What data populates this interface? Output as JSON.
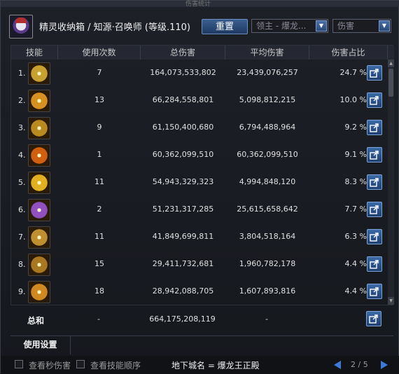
{
  "titlebar": "伤害统计",
  "header": {
    "character": "精灵收纳箱 / 知源·召唤师 (等级.110)",
    "reset_label": "重置",
    "boss_select": "领主 - 爆龙...",
    "type_select": "伤害"
  },
  "columns": [
    "技能",
    "使用次数",
    "总伤害",
    "平均伤害",
    "伤害占比"
  ],
  "rows": [
    {
      "idx": "1.",
      "icon": "skill-icon-1",
      "color": "#c8a030",
      "count": "7",
      "total": "164,073,533,802",
      "avg": "23,439,076,257",
      "pct": "24.7 %"
    },
    {
      "idx": "2.",
      "icon": "skill-icon-2",
      "color": "#d89020",
      "count": "13",
      "total": "66,284,558,801",
      "avg": "5,098,812,215",
      "pct": "10.0 %"
    },
    {
      "idx": "3.",
      "icon": "skill-icon-3",
      "color": "#b88a20",
      "count": "9",
      "total": "61,150,400,680",
      "avg": "6,794,488,964",
      "pct": "9.2 %"
    },
    {
      "idx": "4.",
      "icon": "skill-icon-4",
      "color": "#d06010",
      "count": "1",
      "total": "60,362,099,510",
      "avg": "60,362,099,510",
      "pct": "9.1 %"
    },
    {
      "idx": "5.",
      "icon": "skill-icon-5",
      "color": "#e0b020",
      "count": "11",
      "total": "54,943,329,323",
      "avg": "4,994,848,120",
      "pct": "8.3 %"
    },
    {
      "idx": "6.",
      "icon": "skill-icon-6",
      "color": "#9050c0",
      "count": "2",
      "total": "51,231,317,285",
      "avg": "25,615,658,642",
      "pct": "7.7 %"
    },
    {
      "idx": "7.",
      "icon": "skill-icon-7",
      "color": "#c09030",
      "count": "11",
      "total": "41,849,699,811",
      "avg": "3,804,518,164",
      "pct": "6.3 %"
    },
    {
      "idx": "8.",
      "icon": "skill-icon-8",
      "color": "#a87820",
      "count": "15",
      "total": "29,411,732,681",
      "avg": "1,960,782,178",
      "pct": "4.4 %"
    },
    {
      "idx": "9.",
      "icon": "skill-icon-9",
      "color": "#d08820",
      "count": "18",
      "total": "28,942,088,705",
      "avg": "1,607,893,816",
      "pct": "4.4 %"
    }
  ],
  "total": {
    "label": "总和",
    "count": "-",
    "total": "664,175,208,119",
    "avg": "-"
  },
  "settings_tab": "使用设置",
  "bottom": {
    "check_dps": "查看秒伤害",
    "check_order": "查看技能顺序",
    "dungeon": "地下城名 = 爆龙王正殿",
    "page": "2 / 5"
  }
}
